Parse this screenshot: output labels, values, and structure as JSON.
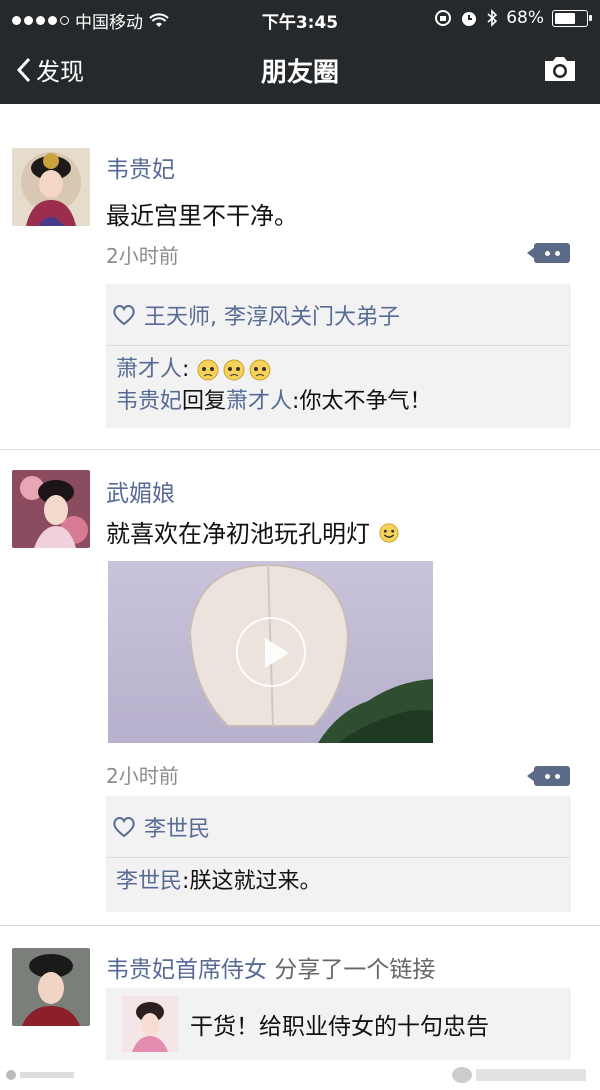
{
  "status_bar": {
    "carrier": "中国移动",
    "time": "下午3:45",
    "battery_percent": "68%",
    "battery_level": 0.68
  },
  "nav": {
    "back_label": "发现",
    "title": "朋友圈",
    "camera_icon": "camera-icon"
  },
  "posts": [
    {
      "author": "韦贵妃",
      "content": "最近宫里不干净。",
      "time": "2小时前",
      "likes": "王天师, 李淳风关门大弟子",
      "comments": [
        {
          "user": "萧才人",
          "sep": ":",
          "text": ""
        },
        {
          "user": "韦贵妃",
          "reply_word": "回复",
          "target": "萧才人",
          "sep": ":",
          "text": "你太不争气！"
        }
      ]
    },
    {
      "author": "武媚娘",
      "content": "就喜欢在净初池玩孔明灯",
      "time": "2小时前",
      "likes": "李世民",
      "comments": [
        {
          "user": "李世民",
          "sep": ":",
          "text": "朕这就过来。"
        }
      ]
    },
    {
      "author": "韦贵妃首席侍女",
      "share_text": "分享了一个链接",
      "link_title": "干货！给职业侍女的十句忠告"
    }
  ],
  "colors": {
    "bar_bg": "#26292b",
    "link_blue": "#576b95",
    "reply_bg": "#f2f2f2"
  }
}
